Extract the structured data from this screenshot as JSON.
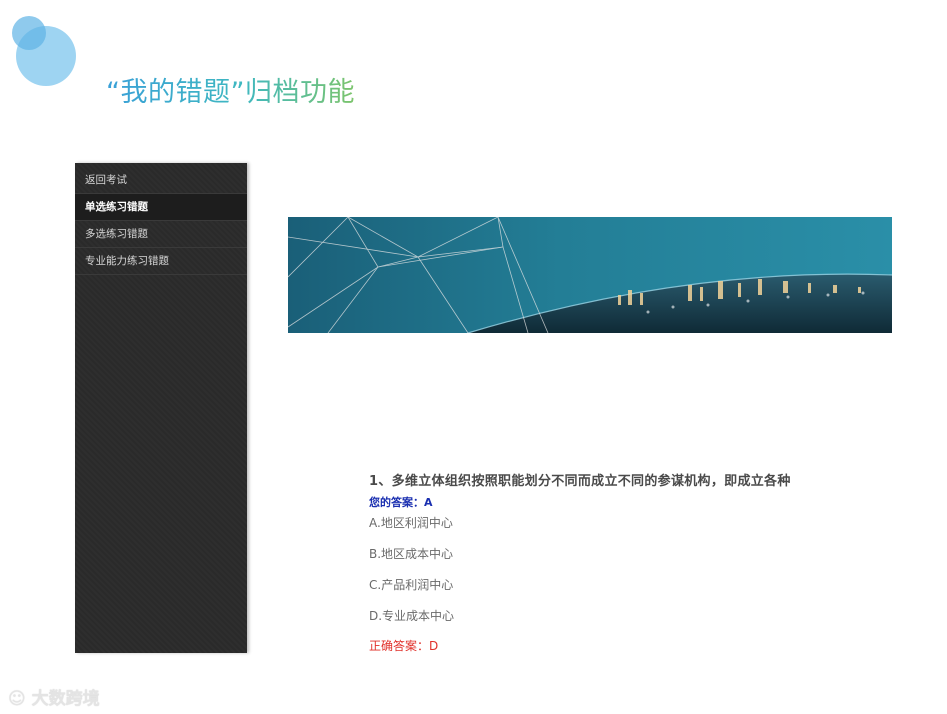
{
  "slide": {
    "title": "“我的错题”归档功能",
    "accent_colors": [
      "#3aa0d8",
      "#3fb8c0",
      "#7cc46b"
    ]
  },
  "sidebar": {
    "items": [
      {
        "label": "返回考试",
        "active": false
      },
      {
        "label": "单选练习错题",
        "active": true
      },
      {
        "label": "多选练习错题",
        "active": false
      },
      {
        "label": "专业能力练习错题",
        "active": false
      }
    ]
  },
  "banner": {
    "description_icon": "city-skyline-banner-image"
  },
  "question": {
    "text": "1、多维立体组织按照职能划分不同而成立不同的参谋机构，即成立各种",
    "your_answer": "您的答案：A",
    "options": [
      "A.地区利润中心",
      "B.地区成本中心",
      "C.产品利润中心",
      "D.专业成本中心"
    ],
    "correct_answer": "正确答案：D",
    "colors": {
      "your_answer": "#1a2fb0",
      "correct": "#e0302a"
    }
  },
  "watermark": {
    "text": "大数跨境"
  }
}
